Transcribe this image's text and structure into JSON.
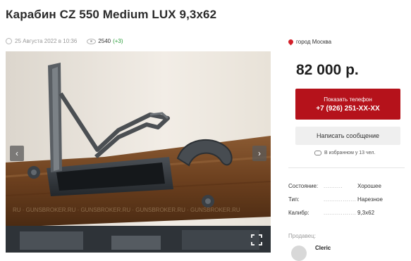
{
  "listing": {
    "title": "Карабин CZ 550 Medium LUX 9,3x62",
    "date": "25 Августа 2022 в 10:36",
    "views": "2540",
    "views_delta": "(+3)"
  },
  "gallery": {
    "prev_glyph": "‹",
    "next_glyph": "›",
    "icons": [
      "chevron-left-icon",
      "chevron-right-icon",
      "fullscreen-icon"
    ]
  },
  "sidebar": {
    "location": "город Москва",
    "price": "82 000 р.",
    "phone_button": {
      "line1": "Показать телефон",
      "line2": "+7 (926) 251-XX-XX"
    },
    "message_button": "Написать сообщение",
    "favorites": "В избранном у 13 чел.",
    "properties": [
      {
        "key": "Состояние:",
        "dots": "..........",
        "value": "Хорошее"
      },
      {
        "key": "Тип:",
        "dots": "....................",
        "value": "Нарезное"
      },
      {
        "key": "Калибр:",
        "dots": "..................",
        "value": "9,3x62"
      }
    ],
    "seller_label": "Продавец:",
    "seller_name": "Cleric"
  },
  "colors": {
    "accent": "#b5121b",
    "views_delta": "#2a9d3a",
    "secondary_button": "#efefef"
  }
}
